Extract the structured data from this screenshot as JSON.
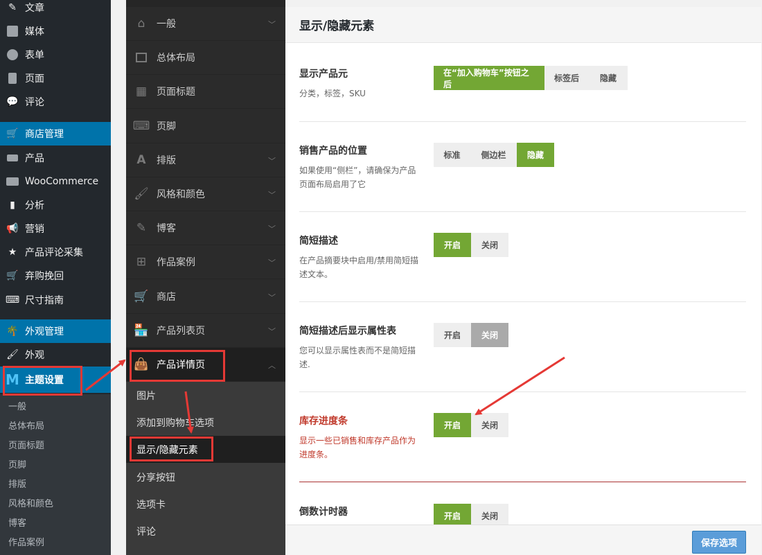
{
  "wp_menu": {
    "items": [
      {
        "label": "文章",
        "icon": "pin-icon"
      },
      {
        "label": "媒体",
        "icon": "media-icon"
      },
      {
        "label": "表单",
        "icon": "form-icon"
      },
      {
        "label": "页面",
        "icon": "page-icon"
      },
      {
        "label": "评论",
        "icon": "comment-icon"
      },
      {
        "label": "商店管理",
        "icon": "store-icon"
      },
      {
        "label": "产品",
        "icon": "product-icon"
      },
      {
        "label": "WooCommerce",
        "icon": "woo-icon"
      },
      {
        "label": "分析",
        "icon": "chart-icon"
      },
      {
        "label": "营销",
        "icon": "megaphone-icon"
      },
      {
        "label": "产品评论采集",
        "icon": "star-icon"
      },
      {
        "label": "弃购挽回",
        "icon": "cart-icon"
      },
      {
        "label": "尺寸指南",
        "icon": "keyboard-icon"
      },
      {
        "label": "外观管理",
        "icon": "palm-icon"
      },
      {
        "label": "外观",
        "icon": "brush-icon"
      },
      {
        "label": "主题设置",
        "icon": "m-logo-icon"
      }
    ],
    "submenu": [
      "一般",
      "总体布局",
      "页面标题",
      "页脚",
      "排版",
      "风格和颜色",
      "博客",
      "作品案例"
    ]
  },
  "options_nav": {
    "items": [
      {
        "label": "一般",
        "icon": "home-icon"
      },
      {
        "label": "总体布局",
        "icon": "layout-icon"
      },
      {
        "label": "页面标题",
        "icon": "grid-icon"
      },
      {
        "label": "页脚",
        "icon": "keyboard-icon"
      },
      {
        "label": "排版",
        "icon": "type-icon"
      },
      {
        "label": "风格和颜色",
        "icon": "brush-icon"
      },
      {
        "label": "博客",
        "icon": "edit-icon"
      },
      {
        "label": "作品案例",
        "icon": "grid-icon"
      },
      {
        "label": "商店",
        "icon": "cart-icon"
      },
      {
        "label": "产品列表页",
        "icon": "shop-icon"
      },
      {
        "label": "产品详情页",
        "icon": "bag-icon"
      }
    ],
    "subitems": [
      "图片",
      "添加到购物车选项",
      "显示/隐藏元素",
      "分享按钮",
      "选项卡",
      "评论"
    ]
  },
  "main": {
    "title": "显示/隐藏元素",
    "rows": [
      {
        "label": "显示产品元",
        "desc": "分类，标签，SKU",
        "options": [
          "在“加入购物车”按钮之后",
          "标签后",
          "隐藏"
        ],
        "selected": 0
      },
      {
        "label": "销售产品的位置",
        "desc": "如果使用“侧栏”，请确保为产品页面布局启用了它",
        "options": [
          "标准",
          "侧边栏",
          "隐藏"
        ],
        "selected": 2
      },
      {
        "label": "简短描述",
        "desc": "在产品摘要块中启用/禁用简短描述文本。",
        "options": [
          "开启",
          "关闭"
        ],
        "selected": 0
      },
      {
        "label": "简短描述后显示属性表",
        "desc": "您可以显示属性表而不是简短描述.",
        "options": [
          "开启",
          "关闭"
        ],
        "selected": 1
      },
      {
        "label": "库存进度条",
        "desc": "显示一些已销售和库存产品作为进度条。",
        "options": [
          "开启",
          "关闭"
        ],
        "selected": 0
      },
      {
        "label": "倒数计时器",
        "desc": "",
        "options": [
          "开启",
          "关闭"
        ],
        "selected": 0
      }
    ],
    "save_label": "保存选项"
  },
  "colors": {
    "accent_green": "#73a734",
    "wp_blue": "#0073aa",
    "annotation_red": "#e53935"
  }
}
